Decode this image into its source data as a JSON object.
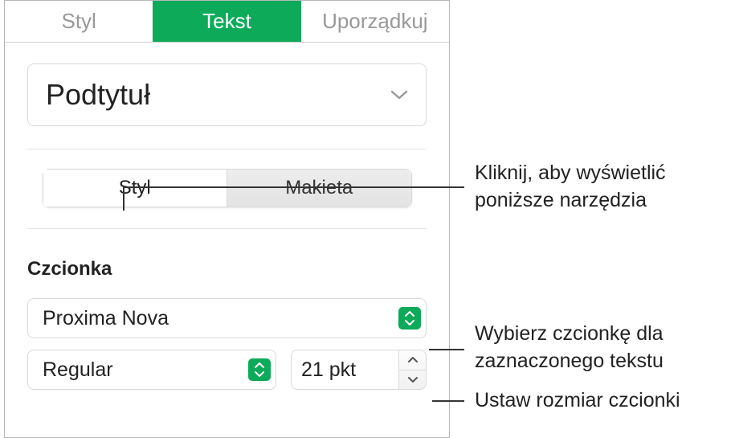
{
  "tabs": {
    "style": "Styl",
    "text": "Tekst",
    "arrange": "Uporządkuj"
  },
  "paragraphStyle": {
    "selected": "Podtytuł"
  },
  "subTabs": {
    "style": "Styl",
    "layout": "Makieta"
  },
  "font": {
    "sectionLabel": "Czcionka",
    "family": "Proxima Nova",
    "weight": "Regular",
    "size": "21 pkt"
  },
  "callouts": {
    "tools": "Kliknij, aby wyświetlić poniższe narzędzia",
    "chooseFont": "Wybierz czcionkę dla zaznaczonego tekstu",
    "setSize": "Ustaw rozmiar czcionki"
  }
}
